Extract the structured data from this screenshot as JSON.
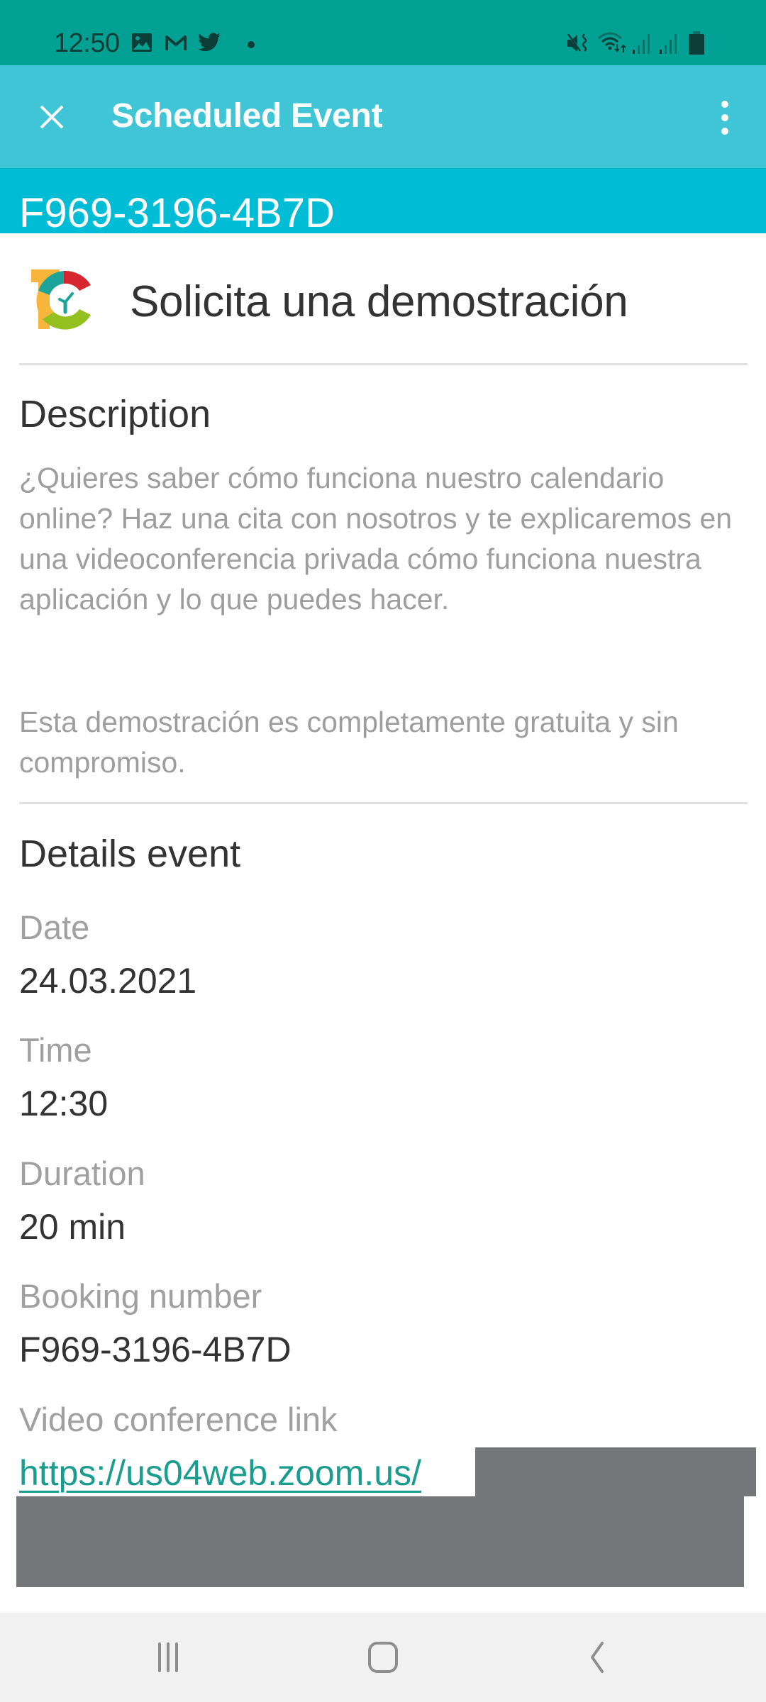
{
  "status_bar": {
    "time": "12:50",
    "notification_icons": [
      "gallery-icon",
      "gmail-icon",
      "twitter-icon",
      "more-notifications-dot"
    ],
    "system_icons": [
      "mute-vibrate-icon",
      "wifi-icon",
      "signal-icon",
      "signal-icon",
      "battery-icon"
    ]
  },
  "app_bar": {
    "title": "Scheduled Event",
    "close_icon": "close-icon",
    "menu_icon": "more-vert-icon"
  },
  "booking_header": {
    "code": "F969-3196-4B7D"
  },
  "event": {
    "title": "Solicita una demostración",
    "logo": "tc-clock-logo"
  },
  "description": {
    "heading": "Description",
    "paragraphs": [
      "¿Quieres saber cómo funciona nuestro calendario online? Haz una cita con nosotros y te explicaremos en una videoconferencia privada cómo funciona nuestra aplicación y lo que puedes hacer.",
      "Esta demostración es completamente gratuita y sin compromiso."
    ]
  },
  "details": {
    "heading": "Details event",
    "fields": [
      {
        "label": "Date",
        "value": "24.03.2021"
      },
      {
        "label": "Time",
        "value": "12:30"
      },
      {
        "label": "Duration",
        "value": "20 min"
      },
      {
        "label": "Booking number",
        "value": "F969-3196-4B7D"
      },
      {
        "label": "Video conference link",
        "value": "https://us04web.zoom.us/"
      }
    ]
  },
  "nav_bar": {
    "buttons": [
      "recents-icon",
      "home-icon",
      "back-icon"
    ]
  },
  "colors": {
    "status_bar": "#03A194",
    "app_bar": "#40C5D6",
    "booking_strip": "#00BCD4",
    "link": "#1A9C8E",
    "redaction": "#74767A"
  }
}
